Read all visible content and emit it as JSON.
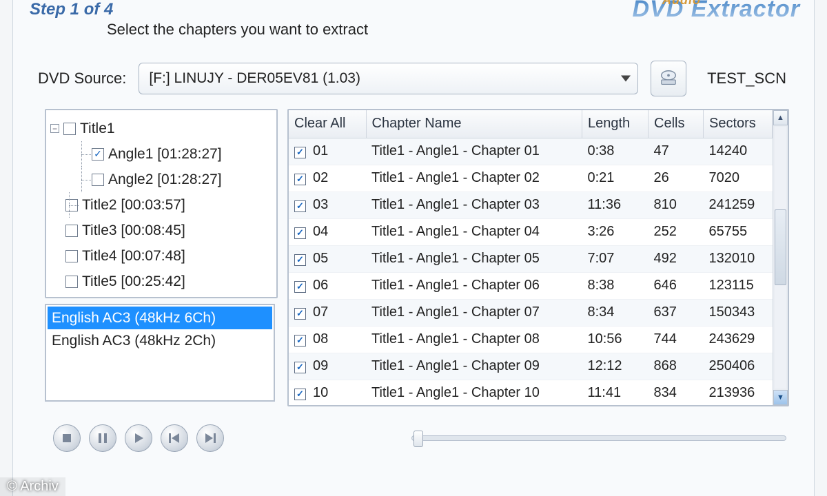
{
  "header": {
    "step_label": "Step 1 of 4",
    "subtitle": "Select the chapters you want to extract",
    "brand_main": "DVD Extractor",
    "brand_sub": "Audio"
  },
  "source": {
    "label": "DVD Source:",
    "selected": "[F:]  LINUJY  - DER05EV81        (1.03)",
    "disc_label": "TEST_SCN"
  },
  "tree": {
    "title1": {
      "label": "Title1",
      "checked": false,
      "expanded": true
    },
    "angle1": {
      "label": "Angle1 [01:28:27]",
      "checked": true
    },
    "angle2": {
      "label": "Angle2 [01:28:27]",
      "checked": false
    },
    "title2": {
      "label": "Title2 [00:03:57]",
      "checked": false
    },
    "title3": {
      "label": "Title3 [00:08:45]",
      "checked": false
    },
    "title4": {
      "label": "Title4 [00:07:48]",
      "checked": false
    },
    "title5": {
      "label": "Title5 [00:25:42]",
      "checked": false
    }
  },
  "audio_tracks": [
    {
      "label": "English AC3 (48kHz 6Ch)",
      "selected": true
    },
    {
      "label": "English AC3 (48kHz 2Ch)",
      "selected": false
    }
  ],
  "table": {
    "headers": {
      "clear_all": "Clear All",
      "chapter_name": "Chapter Name",
      "length": "Length",
      "cells": "Cells",
      "sectors": "Sectors"
    },
    "rows": [
      {
        "num": "01",
        "name": "Title1 - Angle1 - Chapter 01",
        "length": "0:38",
        "cells": "47",
        "sectors": "14240",
        "checked": true
      },
      {
        "num": "02",
        "name": "Title1 - Angle1 - Chapter 02",
        "length": "0:21",
        "cells": "26",
        "sectors": "7020",
        "checked": true
      },
      {
        "num": "03",
        "name": "Title1 - Angle1 - Chapter 03",
        "length": "11:36",
        "cells": "810",
        "sectors": "241259",
        "checked": true
      },
      {
        "num": "04",
        "name": "Title1 - Angle1 - Chapter 04",
        "length": "3:26",
        "cells": "252",
        "sectors": "65755",
        "checked": true
      },
      {
        "num": "05",
        "name": "Title1 - Angle1 - Chapter 05",
        "length": "7:07",
        "cells": "492",
        "sectors": "132010",
        "checked": true
      },
      {
        "num": "06",
        "name": "Title1 - Angle1 - Chapter 06",
        "length": "8:38",
        "cells": "646",
        "sectors": "123115",
        "checked": true
      },
      {
        "num": "07",
        "name": "Title1 - Angle1 - Chapter 07",
        "length": "8:34",
        "cells": "637",
        "sectors": "150343",
        "checked": true
      },
      {
        "num": "08",
        "name": "Title1 - Angle1 - Chapter 08",
        "length": "10:56",
        "cells": "744",
        "sectors": "243629",
        "checked": true
      },
      {
        "num": "09",
        "name": "Title1 - Angle1 - Chapter 09",
        "length": "12:12",
        "cells": "868",
        "sectors": "250406",
        "checked": true
      },
      {
        "num": "10",
        "name": "Title1 - Angle1 - Chapter 10",
        "length": "11:41",
        "cells": "834",
        "sectors": "213936",
        "checked": true
      }
    ]
  },
  "footer": {
    "credit": "© Archiv"
  }
}
